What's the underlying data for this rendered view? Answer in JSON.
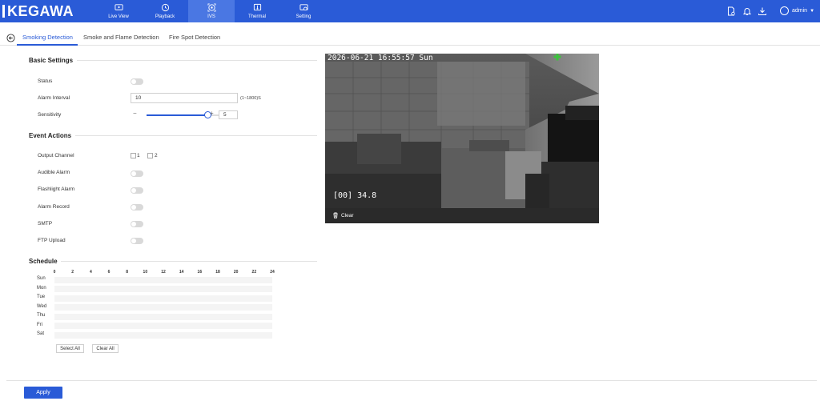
{
  "brand": {
    "name": "KEGAWA"
  },
  "nav": [
    {
      "label": "Live View",
      "icon": "live-view-icon"
    },
    {
      "label": "Playback",
      "icon": "playback-icon"
    },
    {
      "label": "IVS",
      "icon": "ivs-icon",
      "active": true
    },
    {
      "label": "Thermal",
      "icon": "thermal-icon"
    },
    {
      "label": "Setting",
      "icon": "setting-icon"
    }
  ],
  "user": {
    "name": "admin"
  },
  "tabs": [
    {
      "label": "Smoking Detection",
      "active": true
    },
    {
      "label": "Smoke and Flame Detection"
    },
    {
      "label": "Fire Spot Detection"
    }
  ],
  "basic": {
    "title": "Basic Settings",
    "status_label": "Status",
    "alarm_interval_label": "Alarm Interval",
    "alarm_interval_value": "10",
    "alarm_interval_hint": "(1~1800)S",
    "sensitivity_label": "Sensitivity",
    "sensitivity_value": "5",
    "sensitivity_fraction": 0.8,
    "minus": "−",
    "plus": "+"
  },
  "events": {
    "title": "Event Actions",
    "output_channel_label": "Output Channel",
    "channels": [
      "1",
      "2"
    ],
    "audible_alarm": "Audible Alarm",
    "flashlight_alarm": "Flashlight Alarm",
    "alarm_record": "Alarm Record",
    "smtp": "SMTP",
    "ftp_upload": "FTP Upload"
  },
  "schedule": {
    "title": "Schedule",
    "hours": [
      "0",
      "2",
      "4",
      "6",
      "8",
      "10",
      "12",
      "14",
      "16",
      "18",
      "20",
      "22",
      "24"
    ],
    "days": [
      "Sun",
      "Mon",
      "Tue",
      "Wed",
      "Thu",
      "Fri",
      "Sat"
    ],
    "select_all": "Select All",
    "clear_all": "Clear All"
  },
  "video": {
    "timestamp": "2026-06-21 16:55:57 Sun",
    "osd_text": "[00] 34.8",
    "clear_label": "Clear"
  },
  "apply_label": "Apply",
  "colors": {
    "accent": "#2a5bd7",
    "topbar": "#2a5bd7",
    "crosshair": "#3ec23e"
  }
}
